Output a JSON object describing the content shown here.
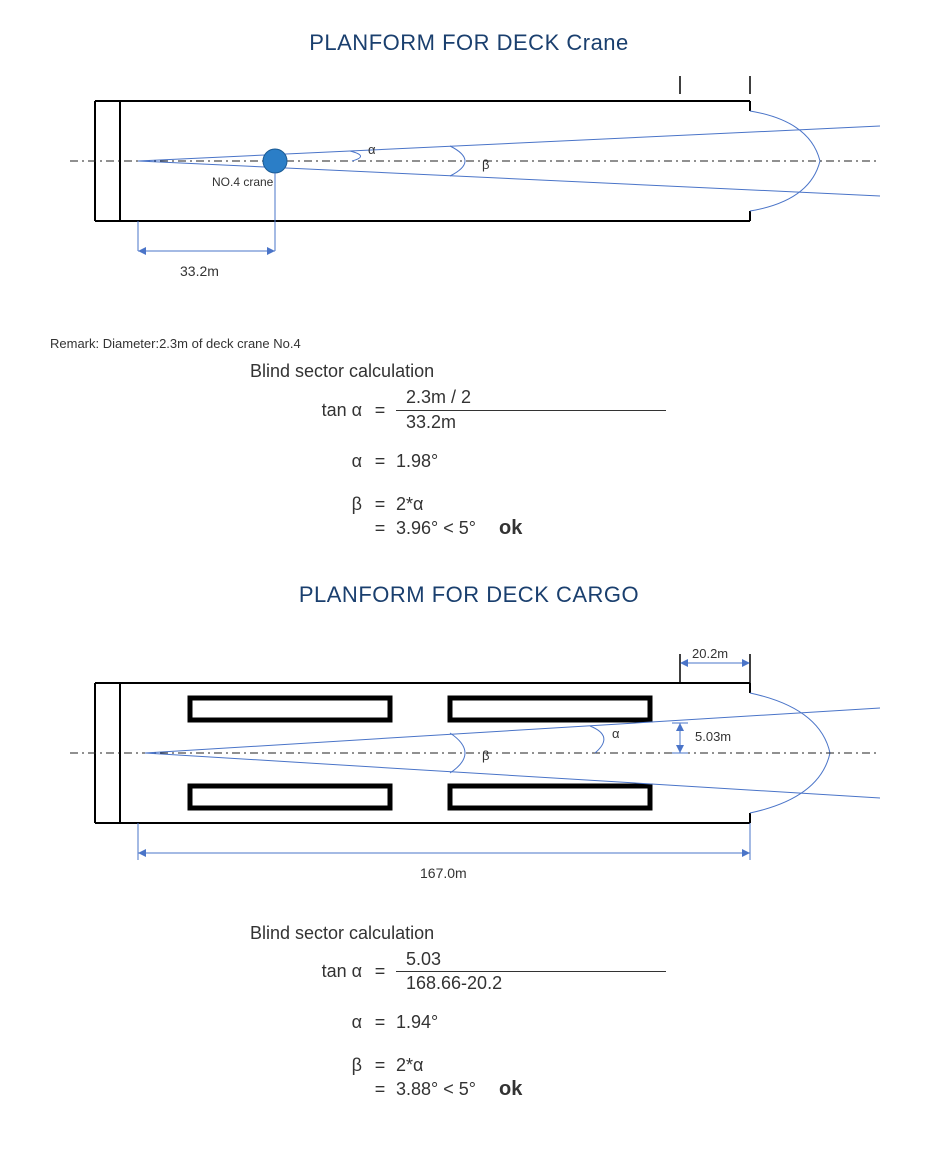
{
  "section1": {
    "title": "PLANFORM FOR DECK Crane",
    "label_crane": "NO.4 crane",
    "alpha_label": "α",
    "beta_label": "β",
    "dim_33_2": "33.2m",
    "remark": "Remark: Diameter:2.3m of deck crane No.4",
    "calc_title": "Blind sector calculation",
    "tan_alpha": "tan α",
    "frac_num": "2.3m / 2",
    "frac_den": "33.2m",
    "alpha_sym": "α",
    "alpha_val": "1.98°",
    "beta_sym": "β",
    "two_alpha": "2*α",
    "beta_result": "3.96° < 5°",
    "ok": "ok"
  },
  "section2": {
    "title": "PLANFORM FOR DECK CARGO",
    "alpha_label": "α",
    "beta_label": "β",
    "dim_20_2": "20.2m",
    "dim_5_03": "5.03m",
    "dim_167": "167.0m",
    "calc_title": "Blind sector calculation",
    "tan_alpha": "tan α",
    "frac_num": "5.03",
    "frac_den": "168.66-20.2",
    "alpha_sym": "α",
    "alpha_val": "1.94°",
    "beta_sym": "β",
    "two_alpha": "2*α",
    "beta_result": "3.88° < 5°",
    "ok": "ok"
  }
}
